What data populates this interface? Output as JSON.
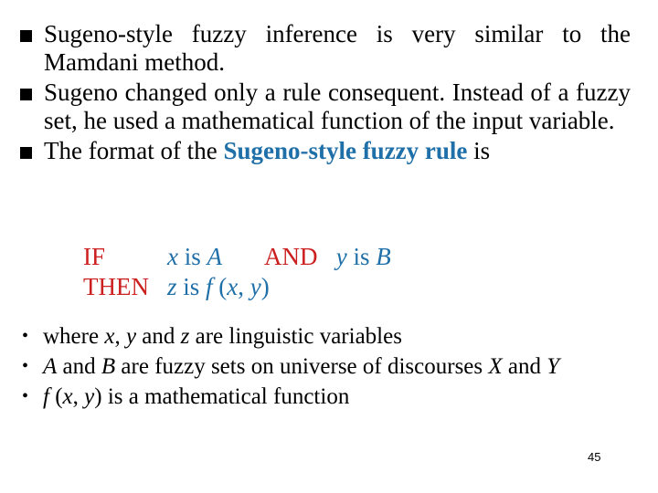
{
  "main_bullets": [
    {
      "text": "Sugeno-style fuzzy inference is very similar to the Mamdani method."
    },
    {
      "text": "Sugeno changed only a rule consequent.  Instead of a fuzzy set, he used a mathematical function of the input variable."
    },
    {
      "prefix": "The format of the ",
      "highlight": "Sugeno-style fuzzy rule",
      "suffix": " is"
    }
  ],
  "rule": {
    "if_keyword": "IF",
    "antecedent1_var": "x",
    "antecedent1_is": " is ",
    "antecedent1_set": "A",
    "and_keyword": "AND",
    "antecedent2_var": "y",
    "antecedent2_is": " is ",
    "antecedent2_set": "B",
    "then_keyword": "THEN",
    "consequent_var": "z",
    "consequent_is": " is ",
    "consequent_func": "f",
    "consequent_args_open": " (",
    "consequent_arg1": "x",
    "consequent_sep": ", ",
    "consequent_arg2": "y",
    "consequent_args_close": ")"
  },
  "sub_bullets": {
    "item1": {
      "t1": "where ",
      "x": "x",
      "c1": ", ",
      "y": "y",
      "t2": " and ",
      "z": "z",
      "t3": " are linguistic variables"
    },
    "item2": {
      "A": "A",
      "t1": " and ",
      "B": "B",
      "t2": " are fuzzy sets on universe of discourses ",
      "X": "X",
      "t3": " and ",
      "Y": "Y"
    },
    "item3": {
      "f": "f",
      "t1": " (",
      "x": "x",
      "c1": ", ",
      "y": "y",
      "t2": ") is a mathematical function"
    }
  },
  "colors": {
    "highlight": "#1f6fa8",
    "keyword": "#cc1f1f"
  },
  "page_number": "45"
}
